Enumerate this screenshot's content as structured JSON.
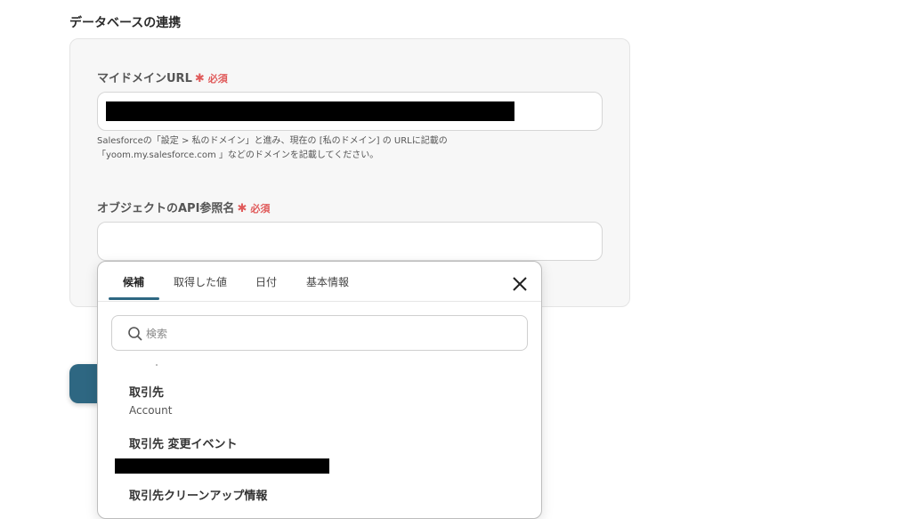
{
  "section_title": "データベースの連携",
  "form": {
    "domain_field": {
      "label": "マイドメインURL",
      "required_label": "必須",
      "help_line1": "Salesforceの「設定 > 私のドメイン」と進み、現在の [私のドメイン] の URLに記載の",
      "help_line2": "「yoom.my.salesforce.com 」などのドメインを記載してください。"
    },
    "object_field": {
      "label": "オブジェクトのAPI参照名",
      "required_label": "必須",
      "value": ""
    }
  },
  "popup": {
    "tabs": [
      {
        "label": "候補",
        "active": true
      },
      {
        "label": "取得した値",
        "active": false
      },
      {
        "label": "日付",
        "active": false
      },
      {
        "label": "基本情報",
        "active": false
      }
    ],
    "search_placeholder": "検索",
    "items": [
      {
        "title": "取引先",
        "subtitle": "Account"
      },
      {
        "title": "取引先 変更イベント",
        "subtitle": ""
      },
      {
        "title": "取引先クリーンアップ情報",
        "subtitle": ""
      }
    ]
  },
  "colors": {
    "accent": "#2e6782",
    "required": "#e05a5a"
  }
}
